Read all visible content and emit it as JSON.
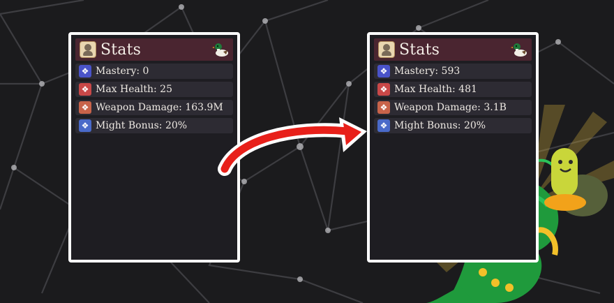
{
  "panels": [
    {
      "title": "Stats",
      "stats": [
        {
          "label": "Mastery: 0",
          "icon": "blue-diamond-icon",
          "color": "#4a53c9"
        },
        {
          "label": "Max Health: 25",
          "icon": "red-diamond-icon",
          "color": "#c94848"
        },
        {
          "label": "Weapon Damage: 163.9M",
          "icon": "orange-diamond-icon",
          "color": "#c8634a"
        },
        {
          "label": "Might Bonus: 20%",
          "icon": "blue-diamond-icon",
          "color": "#4a6ac9"
        }
      ]
    },
    {
      "title": "Stats",
      "stats": [
        {
          "label": "Mastery: 593",
          "icon": "blue-diamond-icon",
          "color": "#4a53c9"
        },
        {
          "label": "Max Health: 481",
          "icon": "red-diamond-icon",
          "color": "#c94848"
        },
        {
          "label": "Weapon Damage: 3.1B",
          "icon": "orange-diamond-icon",
          "color": "#c8634a"
        },
        {
          "label": "Might Bonus: 20%",
          "icon": "blue-diamond-icon",
          "color": "#4a6ac9"
        }
      ]
    }
  ],
  "colors": {
    "panel_header": "#4a2530",
    "panel_bg": "#1e1d22",
    "row_bg": "#2d2b33",
    "arrow": "#e8201a",
    "dragon_green": "#1f9a3c"
  }
}
